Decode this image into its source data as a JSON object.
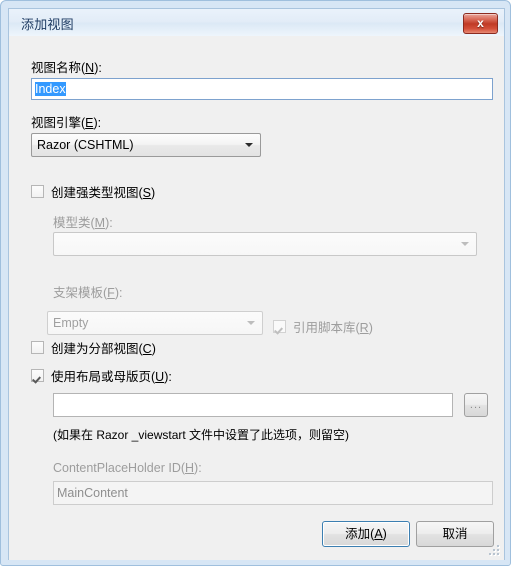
{
  "window": {
    "title": "添加视图",
    "close_icon": "close-x-icon",
    "close_label": "x"
  },
  "fields": {
    "view_name": {
      "label": "视图名称(N):",
      "label_text": "视图名称(",
      "label_accel": "N",
      "label_suffix": "):",
      "value": "Index",
      "selected": true
    },
    "view_engine": {
      "label_text": "视图引擎(",
      "label_accel": "E",
      "label_suffix": "):",
      "value": "Razor (CSHTML)",
      "options": [
        "Razor (CSHTML)"
      ]
    },
    "model_class": {
      "label_text": "模型类(",
      "label_accel": "M",
      "label_suffix": "):",
      "value": "",
      "enabled": false
    },
    "scaffold_template": {
      "label_text": "支架模板(",
      "label_accel": "F",
      "label_suffix": "):",
      "value": "Empty",
      "enabled": false
    },
    "layout_page": {
      "value": "",
      "placeholder": "",
      "browse_label": "...",
      "hint": "(如果在 Razor _viewstart 文件中设置了此选项，则留空)"
    },
    "content_placeholder": {
      "label_text": "ContentPlaceHolder ID(",
      "label_accel": "H",
      "label_suffix": "):",
      "value": "MainContent",
      "enabled": false
    }
  },
  "checkboxes": {
    "strongly_typed": {
      "text": "创建强类型视图(",
      "accel": "S",
      "suffix": ")",
      "checked": false,
      "enabled": true
    },
    "reference_script_libraries": {
      "text": "引用脚本库(",
      "accel": "R",
      "suffix": ")",
      "checked": true,
      "enabled": false
    },
    "partial_view": {
      "text": "创建为分部视图(",
      "accel": "C",
      "suffix": ")",
      "checked": false,
      "enabled": true
    },
    "use_layout": {
      "text": "使用布局或母版页(",
      "accel": "U",
      "suffix": "):",
      "checked": true,
      "enabled": true
    }
  },
  "buttons": {
    "add": {
      "text": "添加(",
      "accel": "A",
      "suffix": ")",
      "is_default": true
    },
    "cancel": {
      "text": "取消"
    }
  },
  "colors": {
    "title_text": "#1f3c63",
    "close_red": "#c03a26",
    "selection_blue": "#3399ff",
    "default_button_border": "#3c7fb1",
    "disabled_text": "#9d9d9d",
    "client_bg": "#f0f0f0",
    "frame_blue": "#d7e6f5"
  }
}
